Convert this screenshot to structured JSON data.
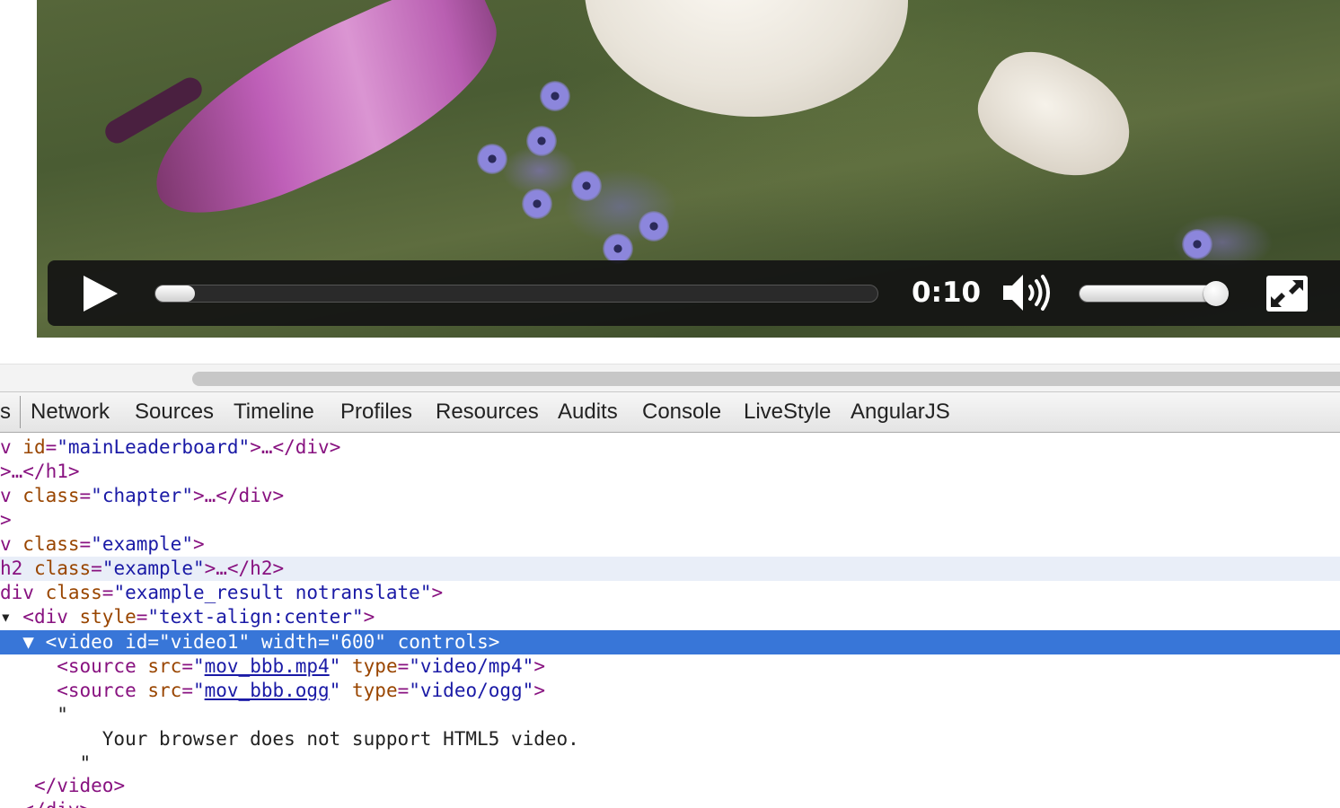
{
  "video_player": {
    "time": "0:10",
    "progress": 0.03,
    "volume": 0.92,
    "icons": [
      "play-icon",
      "volume-icon",
      "fullscreen-icon"
    ]
  },
  "devtools": {
    "tabs": [
      "s",
      "Network",
      "Sources",
      "Timeline",
      "Profiles",
      "Resources",
      "Audits",
      "Console",
      "LiveStyle",
      "AngularJS"
    ]
  },
  "elements": {
    "lines": [
      {
        "id": "l1",
        "parts": [
          {
            "c": "tg",
            "t": "v "
          },
          {
            "c": "an",
            "t": "id"
          },
          {
            "c": "tg",
            "t": "="
          },
          {
            "c": "av",
            "t": "\"mainLeaderboard\""
          },
          {
            "c": "tg",
            "t": ">…</div>"
          }
        ]
      },
      {
        "id": "l2",
        "parts": [
          {
            "c": "tg",
            "t": ">…</h1>"
          }
        ]
      },
      {
        "id": "l3",
        "parts": [
          {
            "c": "tg",
            "t": "v "
          },
          {
            "c": "an",
            "t": "class"
          },
          {
            "c": "tg",
            "t": "="
          },
          {
            "c": "av",
            "t": "\"chapter\""
          },
          {
            "c": "tg",
            "t": ">…</div>"
          }
        ]
      },
      {
        "id": "l4",
        "parts": [
          {
            "c": "tg",
            "t": ">"
          }
        ]
      },
      {
        "id": "l5",
        "parts": [
          {
            "c": "tg",
            "t": "v "
          },
          {
            "c": "an",
            "t": "class"
          },
          {
            "c": "tg",
            "t": "="
          },
          {
            "c": "av",
            "t": "\"example\""
          },
          {
            "c": "tg",
            "t": ">"
          }
        ]
      },
      {
        "id": "l6",
        "parts": [
          {
            "c": "tg",
            "t": "h2 "
          },
          {
            "c": "an",
            "t": "class"
          },
          {
            "c": "tg",
            "t": "="
          },
          {
            "c": "av",
            "t": "\"example\""
          },
          {
            "c": "tg",
            "t": ">…</h2>"
          }
        ]
      },
      {
        "id": "l7",
        "parts": [
          {
            "c": "tg",
            "t": "div "
          },
          {
            "c": "an",
            "t": "class"
          },
          {
            "c": "tg",
            "t": "="
          },
          {
            "c": "av",
            "t": "\"example_result notranslate\""
          },
          {
            "c": "tg",
            "t": ">"
          }
        ]
      },
      {
        "id": "l8",
        "parts": [
          {
            "c": "tx",
            "t": "▾ "
          },
          {
            "c": "tg",
            "t": "<div "
          },
          {
            "c": "an",
            "t": "style"
          },
          {
            "c": "tg",
            "t": "="
          },
          {
            "c": "av",
            "t": "\"text-align:center\""
          },
          {
            "c": "tg",
            "t": ">"
          }
        ]
      },
      {
        "id": "l9",
        "parts": [
          {
            "c": "tx",
            "t": "  ▼ "
          },
          {
            "c": "tg",
            "t": "<video "
          },
          {
            "c": "an",
            "t": "id"
          },
          {
            "c": "tg",
            "t": "="
          },
          {
            "c": "av",
            "t": "\"video1\""
          },
          {
            "c": "tg",
            "t": " "
          },
          {
            "c": "an",
            "t": "width"
          },
          {
            "c": "tg",
            "t": "="
          },
          {
            "c": "av",
            "t": "\"600\""
          },
          {
            "c": "tg",
            "t": " "
          },
          {
            "c": "an",
            "t": "controls"
          },
          {
            "c": "tg",
            "t": ">"
          }
        ]
      },
      {
        "id": "l10",
        "parts": [
          {
            "c": "tx",
            "t": "     "
          },
          {
            "c": "tg",
            "t": "<source "
          },
          {
            "c": "an",
            "t": "src"
          },
          {
            "c": "tg",
            "t": "="
          },
          {
            "c": "av",
            "t": "\""
          },
          {
            "c": "lk",
            "t": "mov_bbb.mp4"
          },
          {
            "c": "av",
            "t": "\""
          },
          {
            "c": "tg",
            "t": " "
          },
          {
            "c": "an",
            "t": "type"
          },
          {
            "c": "tg",
            "t": "="
          },
          {
            "c": "av",
            "t": "\"video/mp4\""
          },
          {
            "c": "tg",
            "t": ">"
          }
        ]
      },
      {
        "id": "l11",
        "parts": [
          {
            "c": "tx",
            "t": "     "
          },
          {
            "c": "tg",
            "t": "<source "
          },
          {
            "c": "an",
            "t": "src"
          },
          {
            "c": "tg",
            "t": "="
          },
          {
            "c": "av",
            "t": "\""
          },
          {
            "c": "lk",
            "t": "mov_bbb.ogg"
          },
          {
            "c": "av",
            "t": "\""
          },
          {
            "c": "tg",
            "t": " "
          },
          {
            "c": "an",
            "t": "type"
          },
          {
            "c": "tg",
            "t": "="
          },
          {
            "c": "av",
            "t": "\"video/ogg\""
          },
          {
            "c": "tg",
            "t": ">"
          }
        ]
      },
      {
        "id": "l12",
        "parts": [
          {
            "c": "tx",
            "t": "     \""
          }
        ]
      },
      {
        "id": "l13",
        "parts": [
          {
            "c": "tx",
            "t": "         Your browser does not support HTML5 video."
          }
        ]
      },
      {
        "id": "l14",
        "parts": [
          {
            "c": "tx",
            "t": "       \""
          }
        ]
      },
      {
        "id": "l15",
        "parts": [
          {
            "c": "tx",
            "t": "   "
          },
          {
            "c": "tg",
            "t": "</video>"
          }
        ]
      },
      {
        "id": "l16",
        "parts": [
          {
            "c": "tx",
            "t": "  "
          },
          {
            "c": "tg",
            "t": "</div>"
          }
        ]
      }
    ]
  },
  "colors": {
    "selection": "#3876d8",
    "hover_row": "#e9eef8",
    "tag": "#881280",
    "attr_name": "#994500",
    "attr_value": "#1a1aa6"
  }
}
